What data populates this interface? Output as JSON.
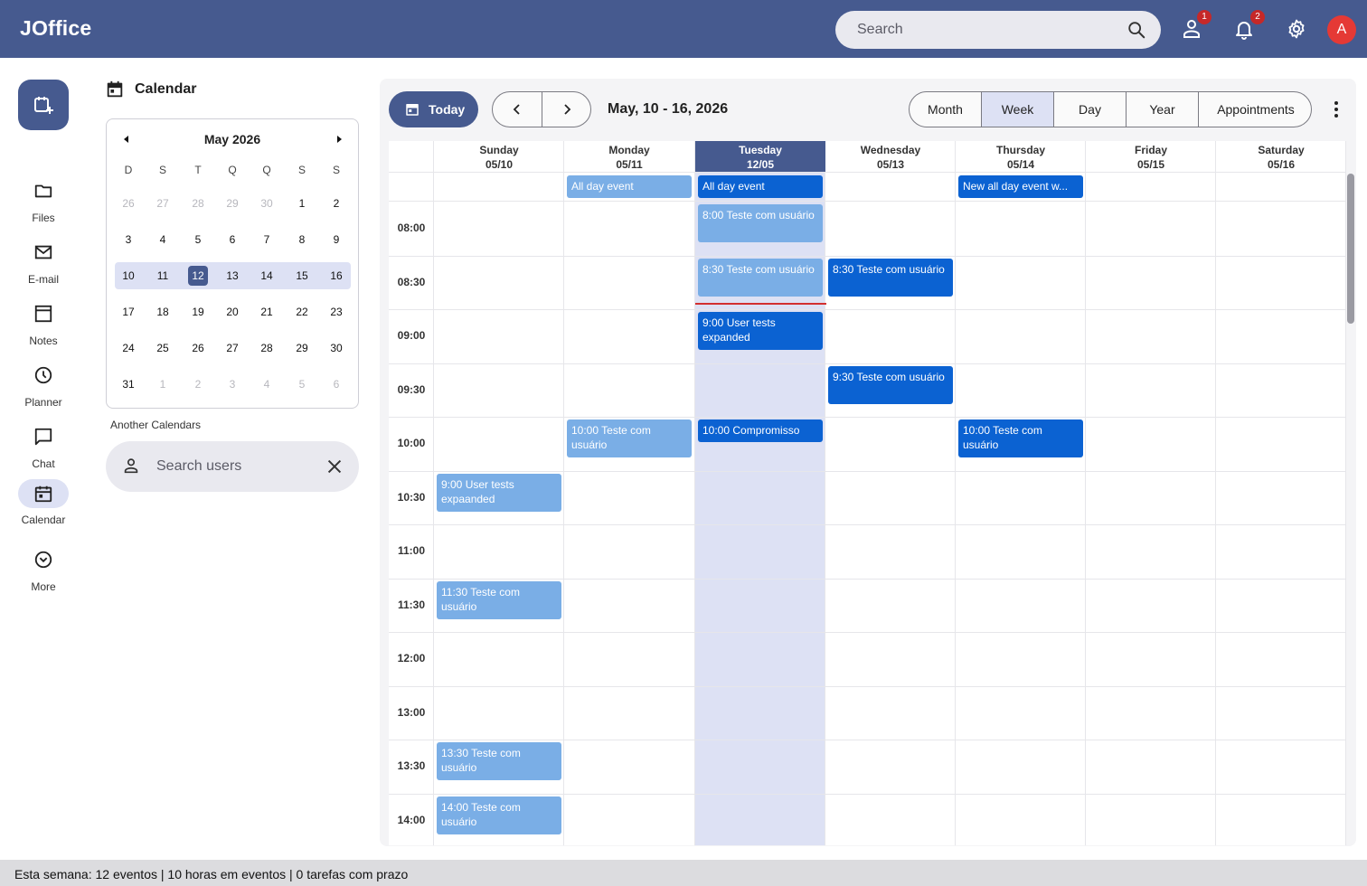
{
  "app": {
    "brand": "JOffice",
    "accent": "#465a8f"
  },
  "topbar": {
    "search_placeholder": "Search",
    "tasks_badge": "1",
    "notifications_badge": "2",
    "avatar_letter": "A"
  },
  "nav": [
    {
      "label": "Files",
      "icon": "folder-icon"
    },
    {
      "label": "E-mail",
      "icon": "mail-icon"
    },
    {
      "label": "Notes",
      "icon": "notes-icon"
    },
    {
      "label": "Planner",
      "icon": "clock-icon"
    },
    {
      "label": "Chat",
      "icon": "chat-icon"
    },
    {
      "label": "Calendar",
      "icon": "calendar-icon",
      "active": true
    },
    {
      "label": "More",
      "icon": "chevron-down-circle-icon"
    }
  ],
  "sidebar": {
    "title": "Calendar",
    "mini": {
      "month_label": "May 2026",
      "weekdays": [
        "D",
        "S",
        "T",
        "Q",
        "Q",
        "S",
        "S"
      ],
      "weeks": [
        [
          "26",
          "27",
          "28",
          "29",
          "30",
          "1",
          "2"
        ],
        [
          "3",
          "4",
          "5",
          "6",
          "7",
          "8",
          "9"
        ],
        [
          "10",
          "11",
          "12",
          "13",
          "14",
          "15",
          "16"
        ],
        [
          "17",
          "18",
          "19",
          "20",
          "21",
          "22",
          "23"
        ],
        [
          "24",
          "25",
          "26",
          "27",
          "28",
          "29",
          "30"
        ],
        [
          "31",
          "1",
          "2",
          "3",
          "4",
          "5",
          "6"
        ]
      ],
      "today": "12"
    },
    "another_label": "Another Calendars",
    "user_search_placeholder": "Search users"
  },
  "toolbar": {
    "today_label": "Today",
    "range_label": "May, 10 - 16, 2026",
    "views": [
      "Month",
      "Week",
      "Day",
      "Year",
      "Appointments"
    ],
    "active_view": "Week"
  },
  "week": {
    "days": [
      {
        "name": "Sunday",
        "date": "05/10"
      },
      {
        "name": "Monday",
        "date": "05/11"
      },
      {
        "name": "Tuesday",
        "date": "12/05",
        "selected": true
      },
      {
        "name": "Wednesday",
        "date": "05/13"
      },
      {
        "name": "Thursday",
        "date": "05/14"
      },
      {
        "name": "Friday",
        "date": "05/15"
      },
      {
        "name": "Saturday",
        "date": "05/16"
      }
    ],
    "times": [
      "08:00",
      "08:30",
      "09:00",
      "09:30",
      "10:00",
      "10:30",
      "11:00",
      "11:30",
      "12:00",
      "13:00",
      "13:30",
      "14:00"
    ],
    "all_day_events": [
      {
        "day": 1,
        "title": "All day event",
        "style": "light"
      },
      {
        "day": 2,
        "title": "All day event",
        "style": "dark"
      },
      {
        "day": 4,
        "title": "New all day event w...",
        "style": "dark"
      }
    ],
    "events": [
      {
        "day": 2,
        "slot": 0,
        "title": "8:00 Teste com usuário",
        "style": "light"
      },
      {
        "day": 2,
        "slot": 1,
        "title": "8:30 Teste com usuário",
        "style": "light"
      },
      {
        "day": 3,
        "slot": 1,
        "title": "8:30 Teste com usuário",
        "style": "dark"
      },
      {
        "day": 2,
        "slot": 2,
        "title": "9:00 User tests expanded",
        "style": "dark"
      },
      {
        "day": 3,
        "slot": 3,
        "title": "9:30 Teste com usuário",
        "style": "dark"
      },
      {
        "day": 1,
        "slot": 4,
        "title": "10:00 Teste com usuário",
        "style": "light"
      },
      {
        "day": 2,
        "slot": 4,
        "title": "10:00 Compromisso",
        "style": "dark",
        "short": true
      },
      {
        "day": 4,
        "slot": 4,
        "title": "10:00 Teste com usuário",
        "style": "dark"
      },
      {
        "day": 0,
        "slot": 5,
        "title": "9:00 User tests expaanded",
        "style": "light"
      },
      {
        "day": 0,
        "slot": 7,
        "title": "11:30 Teste com usuário",
        "style": "light"
      },
      {
        "day": 0,
        "slot": 10,
        "title": "13:30 Teste com usuário",
        "style": "light"
      },
      {
        "day": 0,
        "slot": 11,
        "title": "14:00 Teste com usuário",
        "style": "light"
      }
    ]
  },
  "status_text": "Esta semana: 12 eventos | 10 horas em eventos | 0 tarefas com prazo"
}
